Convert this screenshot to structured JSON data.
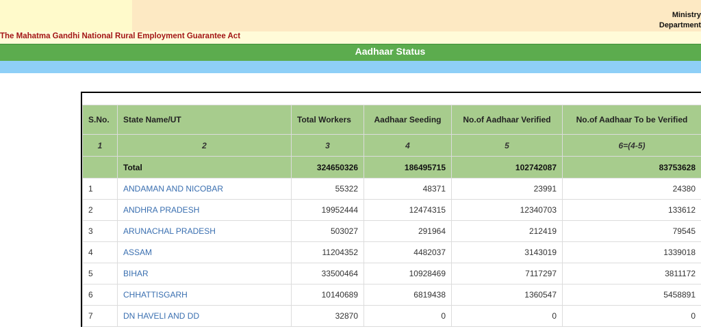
{
  "header": {
    "ministry_line1": "Ministry",
    "ministry_line2": "Department",
    "act_title": "The Mahatma Gandhi National Rural Employment Guarantee Act",
    "page_title": "Aadhaar Status"
  },
  "table": {
    "columns": [
      "S.No.",
      "State Name/UT",
      "Total Workers",
      "Aadhaar Seeding",
      "No.of Aadhaar Verified",
      "No.of Aadhaar To be Verified"
    ],
    "column_numbers": [
      "1",
      "2",
      "3",
      "4",
      "5",
      "6=(4-5)"
    ],
    "total": {
      "label": "Total",
      "total_workers": "324650326",
      "aadhaar_seeding": "186495715",
      "verified": "102742087",
      "to_be_verified": "83753628"
    },
    "rows": [
      {
        "sno": "1",
        "state": "ANDAMAN AND NICOBAR",
        "total_workers": "55322",
        "aadhaar_seeding": "48371",
        "verified": "23991",
        "to_be_verified": "24380"
      },
      {
        "sno": "2",
        "state": "ANDHRA PRADESH",
        "total_workers": "19952444",
        "aadhaar_seeding": "12474315",
        "verified": "12340703",
        "to_be_verified": "133612"
      },
      {
        "sno": "3",
        "state": "ARUNACHAL PRADESH",
        "total_workers": "503027",
        "aadhaar_seeding": "291964",
        "verified": "212419",
        "to_be_verified": "79545"
      },
      {
        "sno": "4",
        "state": "ASSAM",
        "total_workers": "11204352",
        "aadhaar_seeding": "4482037",
        "verified": "3143019",
        "to_be_verified": "1339018"
      },
      {
        "sno": "5",
        "state": "BIHAR",
        "total_workers": "33500464",
        "aadhaar_seeding": "10928469",
        "verified": "7117297",
        "to_be_verified": "3811172"
      },
      {
        "sno": "6",
        "state": "CHHATTISGARH",
        "total_workers": "10140689",
        "aadhaar_seeding": "6819438",
        "verified": "1360547",
        "to_be_verified": "5458891"
      },
      {
        "sno": "7",
        "state": "DN HAVELI AND DD",
        "total_workers": "32870",
        "aadhaar_seeding": "0",
        "verified": "0",
        "to_be_verified": "0"
      }
    ]
  },
  "colors": {
    "green_bar": "#5cac4e",
    "table_header": "#a7cc8d",
    "blue_bar": "#8ecff7",
    "act_title": "#a31515",
    "state_link": "#3a6fb0"
  }
}
